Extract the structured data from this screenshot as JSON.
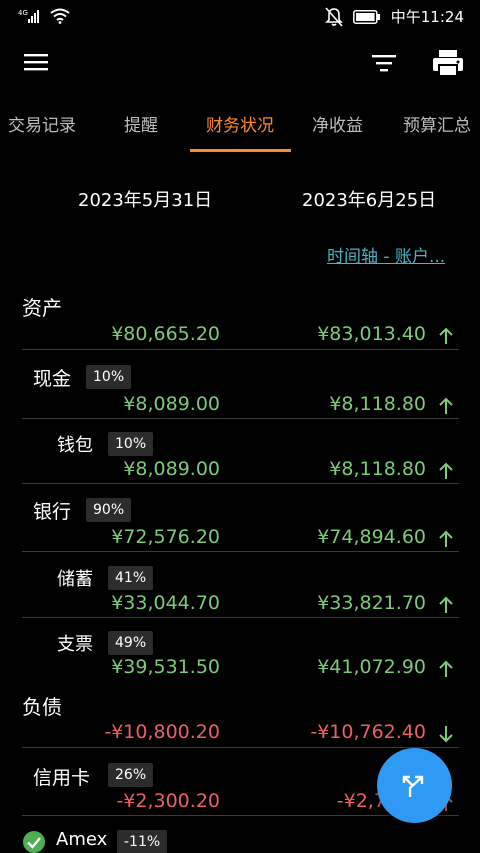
{
  "status_bar": {
    "network": "4G",
    "time": "中午11:24"
  },
  "app_bar": {
    "menu_icon": "hamburger-menu-icon",
    "filter_icon": "filter-icon",
    "print_icon": "printer-icon"
  },
  "tabs": [
    {
      "label": "交易记录",
      "active": false
    },
    {
      "label": "提醒",
      "active": false
    },
    {
      "label": "财务状况",
      "active": true
    },
    {
      "label": "净收益",
      "active": false
    },
    {
      "label": "预算汇总",
      "active": false
    }
  ],
  "dates": {
    "start": "2023年5月31日",
    "end": "2023年6月25日"
  },
  "timeline_link": "时间轴 - 账户...",
  "rows": {
    "assets": {
      "title": "资产",
      "start": "¥80,665.20",
      "end": "¥83,013.40",
      "trend": "up"
    },
    "cash": {
      "title": "现金",
      "pct": "10%",
      "start": "¥8,089.00",
      "end": "¥8,118.80",
      "trend": "up"
    },
    "wallet": {
      "title": "钱包",
      "pct": "10%",
      "start": "¥8,089.00",
      "end": "¥8,118.80",
      "trend": "up"
    },
    "bank": {
      "title": "银行",
      "pct": "90%",
      "start": "¥72,576.20",
      "end": "¥74,894.60",
      "trend": "up"
    },
    "savings": {
      "title": "储蓄",
      "pct": "41%",
      "start": "¥33,044.70",
      "end": "¥33,821.70",
      "trend": "up"
    },
    "checking": {
      "title": "支票",
      "pct": "49%",
      "start": "¥39,531.50",
      "end": "¥41,072.90",
      "trend": "up"
    },
    "liabilities": {
      "title": "负债",
      "start": "-¥10,800.20",
      "end": "-¥10,762.40",
      "trend": "down"
    },
    "credit_card": {
      "title": "信用卡",
      "pct": "26%",
      "start": "-¥2,300.20",
      "end": "-¥2,76",
      "trend": "up"
    },
    "amex": {
      "title": "Amex",
      "pct": "-11%"
    }
  },
  "colors": {
    "accent": "#ff8a2a",
    "positive": "#7ec97a",
    "negative": "#ec5f63",
    "link": "#4bb3c5",
    "fab": "#2f9af3"
  },
  "fab_icon": "split-arrows-icon"
}
